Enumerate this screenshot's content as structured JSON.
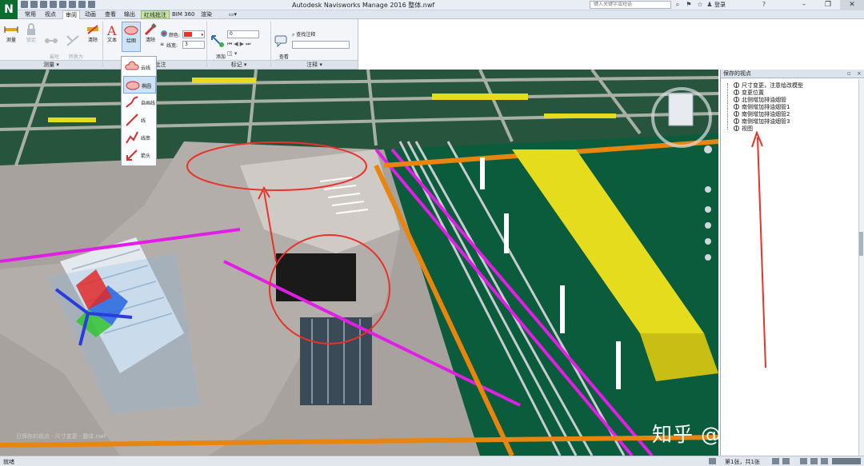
{
  "app": {
    "logo": "N",
    "title": "Autodesk Navisworks Manage 2016    整体.nwf",
    "search_placeholder": "键入关键字或短语",
    "login": "登录",
    "help": "?",
    "window_buttons": [
      "–",
      "❐",
      "✕"
    ]
  },
  "tabs": [
    {
      "label": "常用"
    },
    {
      "label": "视点"
    },
    {
      "label": "审阅"
    },
    {
      "label": "动画"
    },
    {
      "label": "查看"
    },
    {
      "label": "输出"
    },
    {
      "label": "红线批注"
    },
    {
      "label": "BIM 360"
    },
    {
      "label": "渲染"
    }
  ],
  "ribbon": {
    "measure_buttons": [
      {
        "label": "测量"
      },
      {
        "label": "锁定"
      },
      {
        "label": "最短\n距离"
      },
      {
        "label": "转换为\n红线批注"
      },
      {
        "label": "清除"
      }
    ],
    "redline_buttons": [
      {
        "label": "文本"
      },
      {
        "label": "绘图"
      },
      {
        "label": "清除"
      }
    ],
    "color_label": "颜色:",
    "linewidth_label": "线宽:",
    "linewidth_value": "3",
    "add_tag_label": "添加\n标记",
    "tag_number": "0",
    "view_comments_label": "查看\n注释",
    "find_comments_label": "查找注释",
    "panels": {
      "measure": "测量 ▾",
      "redline": "红线批注",
      "tags": "标记 ▾",
      "comments": "注释 ▾"
    }
  },
  "draw_menu": [
    {
      "label": "云线"
    },
    {
      "label": "椭圆"
    },
    {
      "label": "自画线"
    },
    {
      "label": "线"
    },
    {
      "label": "线串"
    },
    {
      "label": "箭头"
    }
  ],
  "viewport": {
    "status_overlay": "已保存的视点 · 尺寸变更 · 整体.nwf",
    "watermark": "知乎 @源海广筑"
  },
  "saved_viewpoints": {
    "title": "保存的视点",
    "items": [
      {
        "label": "尺寸变更，注意给改模型"
      },
      {
        "label": "变更位置"
      },
      {
        "label": "北侧增加排油烟管"
      },
      {
        "label": "南侧增加排油烟管1"
      },
      {
        "label": "南侧增加排油烟管2"
      },
      {
        "label": "南侧增加排油烟管3"
      },
      {
        "label": "视图"
      }
    ]
  },
  "statusbar": {
    "status": "就绪",
    "page": "第1张，共1张"
  },
  "colors": {
    "redline": "#e8322a",
    "floor_green": "#0b5c3d",
    "duct_yellow": "#e6dc1e",
    "pipe_magenta": "#e21ee6",
    "pipe_orange": "#e8850f",
    "wall_grey": "#b4aeaa"
  }
}
